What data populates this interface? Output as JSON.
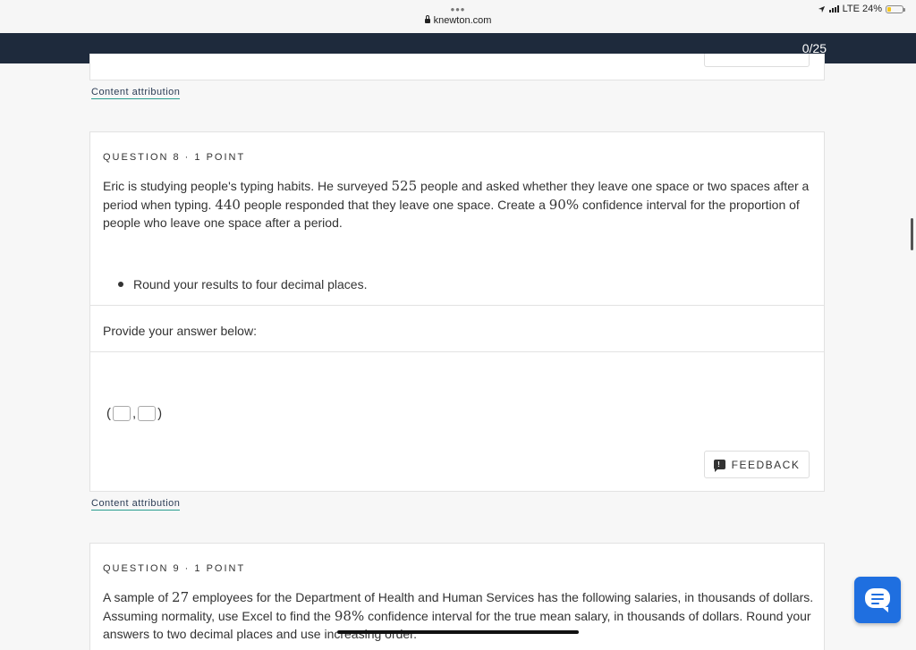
{
  "browser": {
    "menu_dots": "•••",
    "url": "knewton.com",
    "status_right": "LTE 24%",
    "battery_level": 0.24
  },
  "header": {
    "progress": "0/25"
  },
  "attribution_label": "Content attribution",
  "question8": {
    "heading": "QUESTION 8 · 1 POINT",
    "text_parts": [
      "Eric is studying people's typing habits. He surveyed ",
      "525",
      " people and asked whether they leave one space or two spaces after a period when typing. ",
      "440",
      " people responded that they leave one space. Create a ",
      "90%",
      " confidence interval for the proportion of people who leave one space after a period."
    ],
    "bullet": "Round your results to four decimal places.",
    "provide_label": "Provide your answer below:",
    "answer": {
      "open": "(",
      "sep": ",",
      "close": ")",
      "lower": "",
      "upper": ""
    },
    "feedback_label": "FEEDBACK"
  },
  "question9": {
    "heading": "QUESTION 9 · 1 POINT",
    "text_parts": [
      "A sample of ",
      "27",
      " employees for the Department of Health and Human Services has the following salaries, in thousands of dollars. Assuming normality, use Excel to find the ",
      "98%",
      " confidence interval for the true mean salary, in thousands of dollars. Round your answers to two decimal places and use increasing order."
    ]
  },
  "colors": {
    "topbar": "#1e2a3c",
    "chat_button": "#1f6fe0",
    "link_underline": "#2a9d8f"
  },
  "icons": [
    "lock-icon",
    "location-arrow-icon",
    "signal-icon",
    "battery-icon",
    "feedback-icon",
    "chat-icon"
  ]
}
